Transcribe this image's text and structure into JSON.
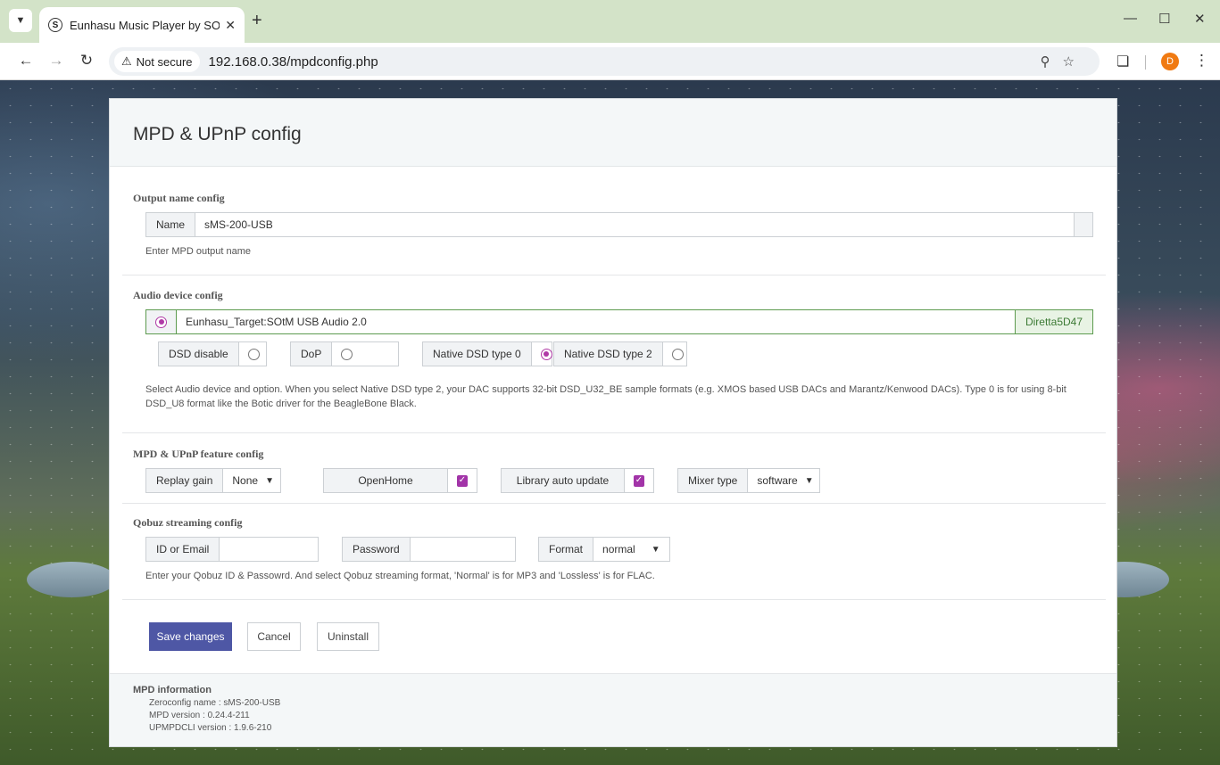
{
  "browser": {
    "tab_title": "Eunhasu Music Player by SOtM",
    "favicon": "S",
    "not_secure": "Not secure",
    "url": "192.168.0.38/mpdconfig.php",
    "profile_initial": "D"
  },
  "page": {
    "title": "MPD & UPnP config"
  },
  "output": {
    "section_title": "Output name config",
    "name_label": "Name",
    "name_value": "sMS-200-USB",
    "help": "Enter MPD output name"
  },
  "audio": {
    "section_title": "Audio device config",
    "device": "Eunhasu_Target:SOtM USB Audio 2.0",
    "device_tag": "Diretta5D47",
    "dsd_disable": "DSD disable",
    "dop": "DoP",
    "native0": "Native DSD type 0",
    "native2": "Native DSD type 2",
    "help": "Select Audio device and option. When you select Native DSD type 2, your DAC supports 32-bit DSD_U32_BE sample formats (e.g. XMOS based USB DACs and Marantz/Kenwood DACs). Type 0 is for using 8-bit DSD_U8 format like the Botic driver for the BeagleBone Black."
  },
  "feature": {
    "section_title": "MPD & UPnP feature config",
    "replay_gain": "Replay gain",
    "replay_value": "None",
    "openhome": "OpenHome",
    "library": "Library auto update",
    "mixer": "Mixer type",
    "mixer_value": "software"
  },
  "qobuz": {
    "section_title": "Qobuz streaming config",
    "id_label": "ID or Email",
    "password_label": "Password",
    "format_label": "Format",
    "format_value": "normal",
    "help": "Enter your Qobuz ID & Passowrd. And select Qobuz streaming format, 'Normal' is for MP3 and 'Lossless' is for FLAC."
  },
  "actions": {
    "save": "Save changes",
    "cancel": "Cancel",
    "uninstall": "Uninstall"
  },
  "info": {
    "title": "MPD information",
    "zeroconf": "Zeroconfig name : sMS-200-USB",
    "mpd_version": "MPD version : 0.24.4-211",
    "upmpdcli_version": "UPMPDCLI version : 1.9.6-210"
  }
}
